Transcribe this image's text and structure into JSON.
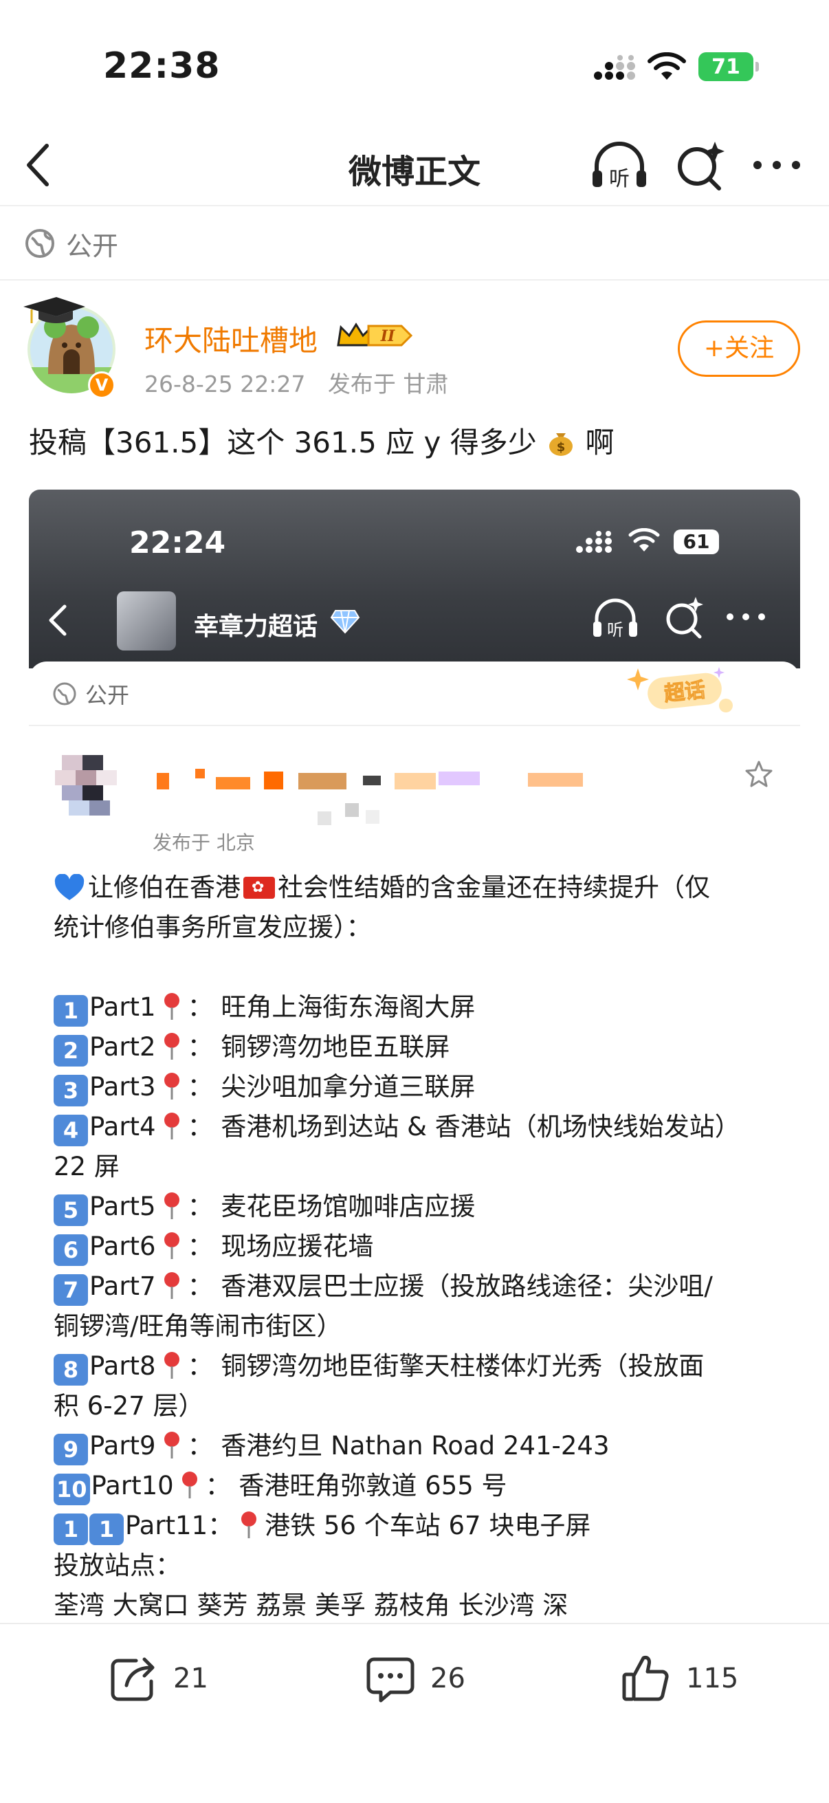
{
  "status_bar": {
    "time": "22:38",
    "battery": "71"
  },
  "nav": {
    "title": "微博正文",
    "listen_label": "听"
  },
  "visibility": {
    "label": "公开"
  },
  "author": {
    "name": "环大陆吐槽地",
    "verified_badge": "V",
    "level_badge": "II",
    "time": "26-8-25 22:27",
    "location": "发布于 甘肃",
    "follow_label": "+关注"
  },
  "post": {
    "text_before": "投稿【361.5】这个 361.5 应 y 得多少",
    "text_after": "啊",
    "emoji_icon": "money-bag-icon"
  },
  "embedded_screenshot": {
    "status_time": "22:24",
    "battery": "61",
    "group_name": "幸章力超话",
    "listen_label": "听",
    "visibility_label": "公开",
    "supertopic_badge": "超话",
    "location": "发布于 北京",
    "intro_lines": [
      "让修伯在香港",
      "社会性结婚的含金量还在持续提升（仅",
      "统计修伯事务所宣发应援）："
    ],
    "items": [
      {
        "num": "1",
        "part": "Part1",
        "text": "： 旺角上海街东海阁大屏"
      },
      {
        "num": "2",
        "part": "Part2",
        "text": "： 铜锣湾勿地臣五联屏"
      },
      {
        "num": "3",
        "part": "Part3",
        "text": "： 尖沙咀加拿分道三联屏"
      },
      {
        "num": "4",
        "part": "Part4",
        "text": "： 香港机场到达站 & 香港站（机场快线始发站）"
      },
      {
        "num": "5",
        "part": "Part5",
        "text": "： 麦花臣场馆咖啡店应援"
      },
      {
        "num": "6",
        "part": "Part6",
        "text": "： 现场应援花墙"
      },
      {
        "num": "7",
        "part": "Part7",
        "text": "： 香港双层巴士应援（投放路线途径：尖沙咀/"
      },
      {
        "num": "8",
        "part": "Part8",
        "text": "： 铜锣湾勿地臣街擎天柱楼体灯光秀（投放面"
      },
      {
        "num": "9",
        "part": "Part9",
        "text": "： 香港约旦 Nathan Road 241-243"
      },
      {
        "num": "10",
        "part": "Part10",
        "text": "： 香港旺角弥敦道 655 号"
      }
    ],
    "continuations": {
      "item4": "22 屏",
      "item7": "铜锣湾/旺角等闹市街区）",
      "item8": "积 6-27 层）"
    },
    "item11": {
      "num_a": "1",
      "num_b": "1",
      "part": "Part11",
      "colon": "：",
      "text": "港铁 56 个车站 67 块电子屏"
    },
    "stations_label": "投放站点：",
    "stations_line": "荃湾  大窝口  葵芳  荔景  美孚  荔枝角  长沙湾  深"
  },
  "actions": {
    "repost_count": "21",
    "comment_count": "26",
    "like_count": "115"
  },
  "colors": {
    "orange": "#ff8200",
    "blue_keycap": "#4f8ad9",
    "battery_green": "#34c759"
  }
}
